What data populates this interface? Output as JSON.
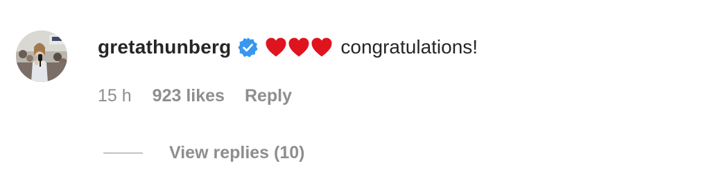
{
  "comment": {
    "avatar_icon": "profile-photo",
    "username": "gretathunberg",
    "verified_icon": "verified-badge-icon",
    "verified_color": "#3897f0",
    "emoji": [
      "❤️",
      "❤️",
      "❤️"
    ],
    "heart_color": "#e0141e",
    "text": "congratulations!",
    "time": "15 h",
    "likes": "923 likes",
    "reply_label": "Reply",
    "view_replies_label": "View replies (10)"
  }
}
